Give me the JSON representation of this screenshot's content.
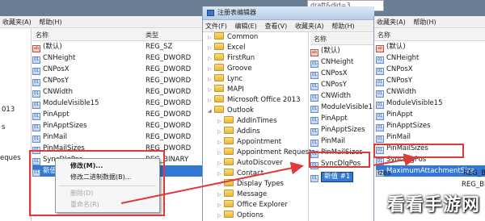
{
  "background_color": "#6b7d93",
  "address_bar": {
    "text": "draft&did=3"
  },
  "window1": {
    "menus": [
      "收藏夹(A)",
      "帮助(H)"
    ],
    "col_name": "名称",
    "col_type": "类型",
    "side_fragments": [
      "013",
      "s",
      "eques"
    ],
    "rows": [
      {
        "icon": "string-value-icon",
        "name": "(默认)",
        "type": "REG_SZ"
      },
      {
        "icon": "dword-value-icon",
        "name": "CNHeight",
        "type": "REG_DWORD"
      },
      {
        "icon": "dword-value-icon",
        "name": "CNPosX",
        "type": "REG_DWORD"
      },
      {
        "icon": "dword-value-icon",
        "name": "CNPosY",
        "type": "REG_DWORD"
      },
      {
        "icon": "dword-value-icon",
        "name": "CNWidth",
        "type": "REG_DWORD"
      },
      {
        "icon": "dword-value-icon",
        "name": "ModuleVisible15",
        "type": "REG_DWORD"
      },
      {
        "icon": "dword-value-icon",
        "name": "PinAppt",
        "type": "REG_DWORD"
      },
      {
        "icon": "dword-value-icon",
        "name": "PinApptSizes",
        "type": "REG_DWORD"
      },
      {
        "icon": "dword-value-icon",
        "name": "PinMail",
        "type": "REG_DWORD"
      },
      {
        "icon": "dword-value-icon",
        "name": "PinMailSizes",
        "type": "REG_DWORD"
      },
      {
        "icon": "dword-value-icon",
        "name": "SyncDlgPos",
        "type": "REG_BINARY"
      },
      {
        "icon": "dword-value-icon",
        "name": "新值",
        "type": "",
        "selected": true
      }
    ],
    "context_menu": {
      "items": [
        {
          "label": "修改(M)...",
          "disabled": false
        },
        {
          "label": "修改二进制数据(B)...",
          "disabled": false
        },
        {
          "label": "删除(D)",
          "disabled": true
        },
        {
          "label": "重命名(R)",
          "disabled": true
        }
      ]
    }
  },
  "window2": {
    "title": "注册表编辑器",
    "menus": [
      "文件(F)",
      "编辑(E)",
      "查看(V)",
      "收藏夹(A)",
      "帮助(H)"
    ],
    "tree": [
      {
        "label": "Common",
        "level": 0
      },
      {
        "label": "Excel",
        "level": 0
      },
      {
        "label": "FirstRun",
        "level": 0
      },
      {
        "label": "Groove",
        "level": 0
      },
      {
        "label": "Lync",
        "level": 0
      },
      {
        "label": "MAPI",
        "level": 0
      },
      {
        "label": "Microsoft Office 2013",
        "level": 0
      },
      {
        "label": "Outlook",
        "level": 0,
        "expanded": true
      },
      {
        "label": "AddInTimes",
        "level": 1
      },
      {
        "label": "Addins",
        "level": 1
      },
      {
        "label": "Appointment",
        "level": 1
      },
      {
        "label": "Appointment Requests",
        "level": 1
      },
      {
        "label": "AutoDiscover",
        "level": 1
      },
      {
        "label": "Contact",
        "level": 1
      },
      {
        "label": "Display Types",
        "level": 1
      },
      {
        "label": "Message",
        "level": 1
      },
      {
        "label": "Office Explorer",
        "level": 1
      },
      {
        "label": "Options",
        "level": 1
      }
    ],
    "list_header": "名称",
    "list_rows": [
      {
        "icon": "string-value-icon",
        "name": "(默认)"
      },
      {
        "icon": "dword-value-icon",
        "name": "CNHeight"
      },
      {
        "icon": "dword-value-icon",
        "name": "CNPosX"
      },
      {
        "icon": "dword-value-icon",
        "name": "CNPosY"
      },
      {
        "icon": "dword-value-icon",
        "name": "CNWidth"
      },
      {
        "icon": "dword-value-icon",
        "name": "ModuleVisible1"
      },
      {
        "icon": "dword-value-icon",
        "name": "PinAppt"
      },
      {
        "icon": "dword-value-icon",
        "name": "PinApptSizes"
      },
      {
        "icon": "dword-value-icon",
        "name": "PinMail"
      },
      {
        "icon": "dword-value-icon",
        "name": "PinMailSizes"
      },
      {
        "icon": "dword-value-icon",
        "name": "SyncDlgPos"
      }
    ],
    "edit_value": "新值 #1"
  },
  "window3": {
    "menus": [
      "收藏夹(A)",
      "帮助(H)"
    ],
    "list_header": "名称",
    "rows": [
      {
        "icon": "string-value-icon",
        "name": "(默认)"
      },
      {
        "icon": "dword-value-icon",
        "name": "CNHeight"
      },
      {
        "icon": "dword-value-icon",
        "name": "CNPosX"
      },
      {
        "icon": "dword-value-icon",
        "name": "CNPosY"
      },
      {
        "icon": "dword-value-icon",
        "name": "CNWidth"
      },
      {
        "icon": "dword-value-icon",
        "name": "ModuleVisible15"
      },
      {
        "icon": "dword-value-icon",
        "name": "PinAppt"
      },
      {
        "icon": "dword-value-icon",
        "name": "PinApptSizes"
      },
      {
        "icon": "dword-value-icon",
        "name": "PinMail"
      },
      {
        "icon": "dword-value-icon",
        "name": "PinMailSizes"
      },
      {
        "icon": "dword-value-icon",
        "name": "SyncDlgPos"
      },
      {
        "icon": "dword-value-icon",
        "name": "MaximumAttachmentSize",
        "selected": true
      }
    ],
    "below_fragments": {
      "left": "izes",
      "type1": "REG_B",
      "type2": "REG_BI"
    }
  },
  "watermark": {
    "text": "看看手游网",
    "color": "#ffffff"
  },
  "annotation_color": "#e0393b"
}
